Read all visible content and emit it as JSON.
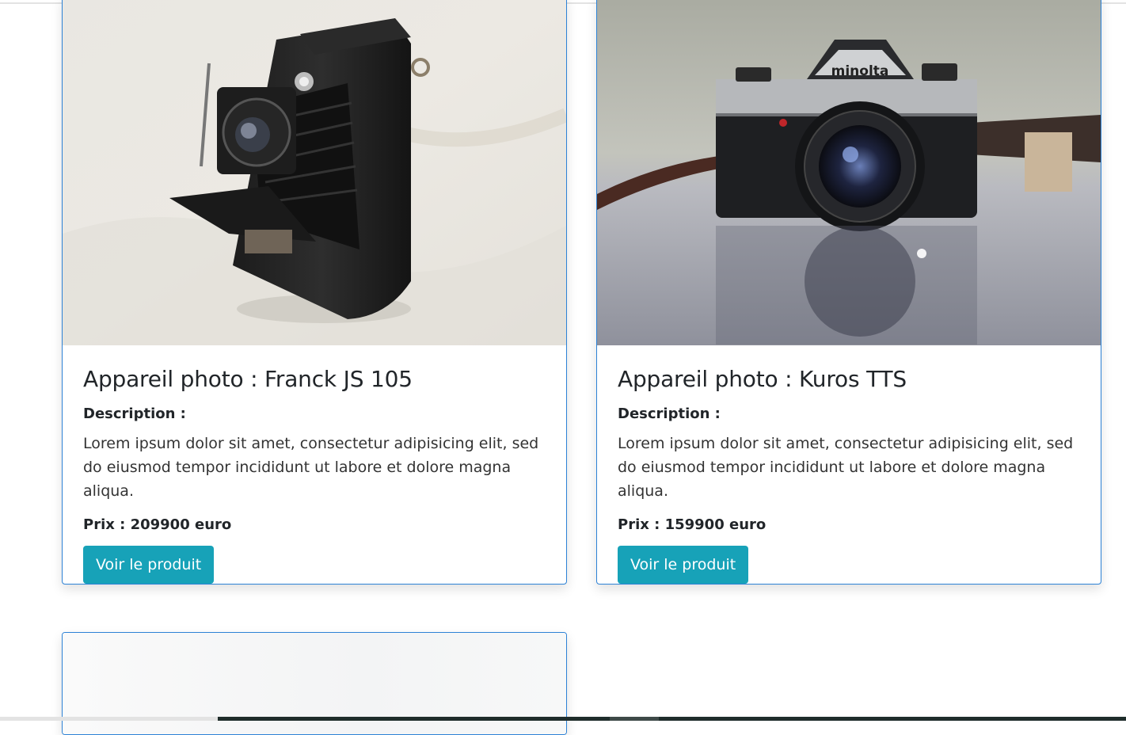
{
  "products": [
    {
      "title": "Appareil photo : Franck JS 105",
      "description_label": "Description :",
      "description": "Lorem ipsum dolor sit amet, consectetur adipisicing elit, sed do eiusmod tempor incididunt ut labore et dolore magna aliqua.",
      "price": "Prix : 209900 euro",
      "button_label": "Voir le produit",
      "image_icon": "vintage-folding-camera-image"
    },
    {
      "title": "Appareil photo : Kuros TTS",
      "description_label": "Description :",
      "description": "Lorem ipsum dolor sit amet, consectetur adipisicing elit, sed do eiusmod tempor incididunt ut labore et dolore magna aliqua.",
      "price": "Prix : 159900 euro",
      "button_label": "Voir le produit",
      "image_icon": "slr-camera-image",
      "camera_brand": "minolta"
    }
  ],
  "colors": {
    "card_border": "#2d82d6",
    "button_bg": "#17a2b8",
    "button_text": "#ffffff"
  }
}
